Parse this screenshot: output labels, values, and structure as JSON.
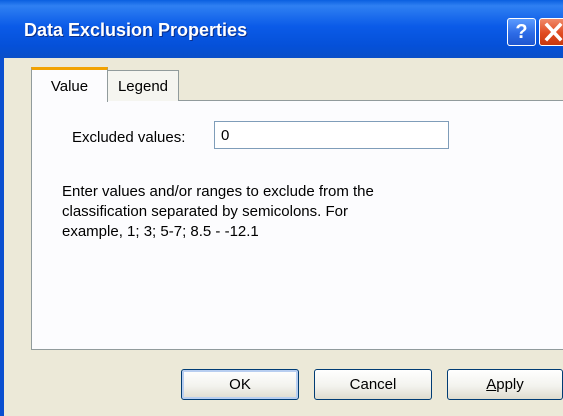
{
  "window": {
    "title": "Data Exclusion Properties",
    "help_glyph": "?",
    "close_icon": "close-icon"
  },
  "tabs": [
    {
      "label": "Value",
      "selected": true
    },
    {
      "label": "Legend",
      "selected": false
    }
  ],
  "value_tab": {
    "excluded_label": "Excluded values:",
    "excluded_value": "0",
    "help_text_lines": [
      "Enter values and/or ranges to exclude from the",
      "classification separated by semicolons. For",
      "example, 1; 3; 5-7; 8.5 - -12.1"
    ]
  },
  "buttons": {
    "ok": "OK",
    "cancel": "Cancel",
    "apply_mnemonic": "A",
    "apply_rest": "pply"
  },
  "colors": {
    "titlebar": "#0B5BE8",
    "dialog_bg": "#ECE9D8",
    "active_tab_accent": "#F2A200",
    "close_red": "#E04A20"
  }
}
